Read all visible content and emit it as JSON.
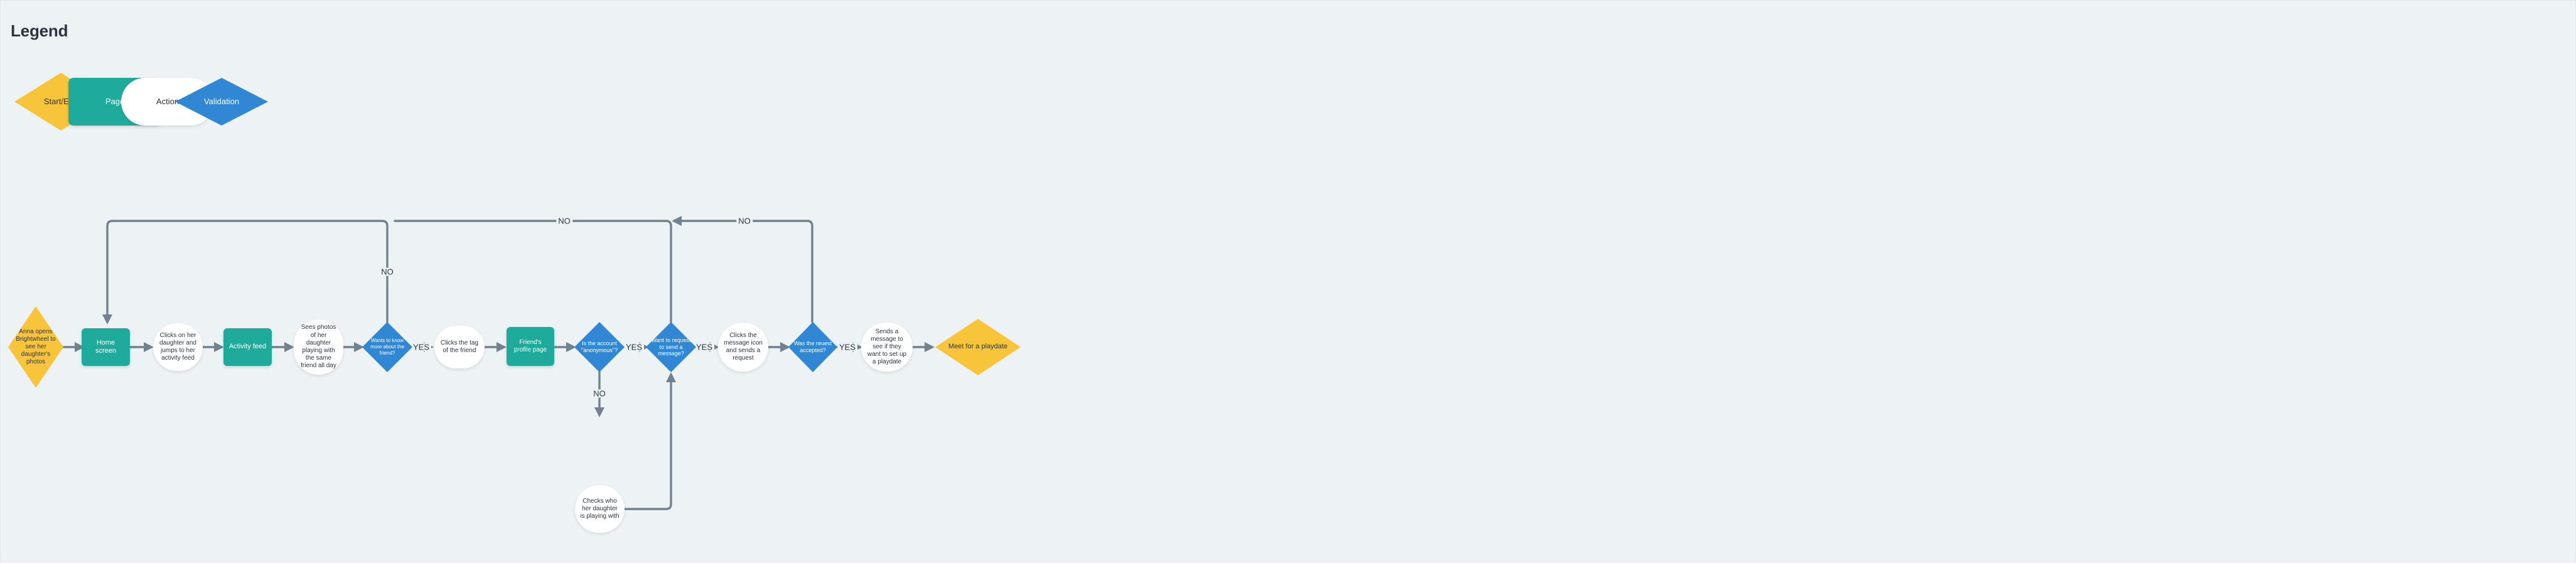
{
  "legend": {
    "title": "Legend",
    "items": [
      {
        "label": "Start/End",
        "shape": "diamond",
        "color": "#f8c53a"
      },
      {
        "label": "Page",
        "shape": "rect",
        "color": "#1fab9b"
      },
      {
        "label": "Action",
        "shape": "pill",
        "color": "#ffffff"
      },
      {
        "label": "Validation",
        "shape": "diamond",
        "color": "#3088d4"
      }
    ]
  },
  "flow": {
    "nodes": [
      {
        "id": "start",
        "label": "Anna opens Brightwheel to see her daughter's photos",
        "type": "start"
      },
      {
        "id": "home",
        "label": "Home screen",
        "type": "page"
      },
      {
        "id": "clicks_dau",
        "label": "Clicks on her daughter and jumps to her activity feed",
        "type": "action"
      },
      {
        "id": "activity",
        "label": "Activity feed",
        "type": "page"
      },
      {
        "id": "sees_photos",
        "label": "Sees photos of her daughter playing with the same friend all day",
        "type": "action"
      },
      {
        "id": "know_more",
        "label": "Wants to know more about the friend?",
        "type": "validation"
      },
      {
        "id": "clicks_tag",
        "label": "Clicks the tag of the friend",
        "type": "action"
      },
      {
        "id": "profile",
        "label": "Friend's profile page",
        "type": "page"
      },
      {
        "id": "anonymous",
        "label": "Is the account \"anonymous\"?",
        "type": "validation"
      },
      {
        "id": "want_request",
        "label": "Want to request to send a message?",
        "type": "validation"
      },
      {
        "id": "clicks_msg",
        "label": "Clicks the message icon and sends a request",
        "type": "action"
      },
      {
        "id": "accepted",
        "label": "Was the reuest accepted?",
        "type": "validation"
      },
      {
        "id": "sends_msg",
        "label": "Sends a message to see if they want to set up a playdate",
        "type": "action"
      },
      {
        "id": "end",
        "label": "Meet for a playdate",
        "type": "start"
      },
      {
        "id": "checks_who",
        "label": "Checks who her daughter is playing with",
        "type": "action"
      }
    ],
    "edge_labels": {
      "know_more_yes": "YES",
      "know_more_no": "NO",
      "anonymous_yes": "YES",
      "anonymous_no": "NO",
      "want_request_yes": "YES",
      "want_request_no": "NO",
      "accepted_yes": "YES",
      "accepted_no": "NO"
    }
  },
  "colors": {
    "background": "#edf2f4",
    "start_end": "#f8c53a",
    "page": "#1fab9b",
    "action": "#ffffff",
    "validation": "#3088d4",
    "connector": "#72818f",
    "text_dark": "#2b3440"
  }
}
